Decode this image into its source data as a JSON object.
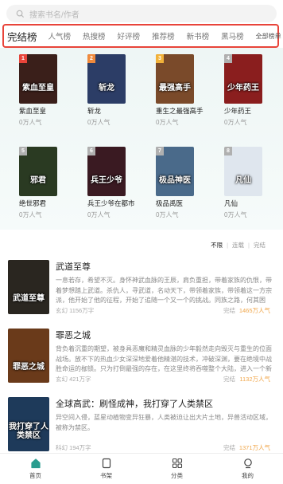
{
  "search": {
    "placeholder": "搜索书名/作者"
  },
  "rank_tabs": {
    "items": [
      "完结榜",
      "人气榜",
      "热搜榜",
      "好评榜",
      "推荐榜",
      "新书榜",
      "黑马榜"
    ],
    "all_label": "全部榜单",
    "all_chevron": "›"
  },
  "rank_books": [
    {
      "rank": "1",
      "title": "紫血至皇",
      "pop": "0万人气",
      "cover_text": "紫血至皇",
      "rank_color": "#e8443a",
      "cover_color": "#3a1f1a"
    },
    {
      "rank": "2",
      "title": "斩龙",
      "pop": "0万人气",
      "cover_text": "斩龙",
      "rank_color": "#f08a3c",
      "cover_color": "#2c3d66"
    },
    {
      "rank": "3",
      "title": "重生之最强高手",
      "pop": "0万人气",
      "cover_text": "最强高手",
      "rank_color": "#f2b23a",
      "cover_color": "#7a4a2a"
    },
    {
      "rank": "4",
      "title": "少年药王",
      "pop": "0万人气",
      "cover_text": "少年药王",
      "rank_color": "#b0b0b0",
      "cover_color": "#8a1e1e"
    },
    {
      "rank": "5",
      "title": "绝世邪君",
      "pop": "0万人气",
      "cover_text": "邪君",
      "rank_color": "#b0b0b0",
      "cover_color": "#2a3a22"
    },
    {
      "rank": "6",
      "title": "兵王少爷在都市",
      "pop": "0万人气",
      "cover_text": "兵王少爷",
      "rank_color": "#b0b0b0",
      "cover_color": "#3a1a22"
    },
    {
      "rank": "7",
      "title": "极品禹医",
      "pop": "0万人气",
      "cover_text": "极品神医",
      "rank_color": "#b0b0b0",
      "cover_color": "#4a6a8a"
    },
    {
      "rank": "8",
      "title": "凡仙",
      "pop": "0万人气",
      "cover_text": "凡仙",
      "rank_color": "#b0b0b0",
      "cover_color": "#dfe6ee"
    }
  ],
  "sort": {
    "options": [
      "不限",
      "连载",
      "完结"
    ]
  },
  "list_books": [
    {
      "title": "武道至尊",
      "desc": "一息若存，希望不灭。身怀神武血脉的王辰，肩负重担，带着家族的仇恨，带着梦想踏上武道。杀仇人，寻武道，名动天下，带领着家族，带领着这一方宗派，他开始了他的征程，开始了追随一个又一个的挑战。同族之路，何其困难。",
      "meta": "玄幻 1156万字",
      "status": "完结",
      "pop": "1465万人气",
      "cover_text": "武道至尊",
      "cover_color": "#2a2620"
    },
    {
      "title": "罪恶之城",
      "desc": "背负着沉重的期望，被身具恶魔和精灵血脉的少年毅然走向毁灭与重生的位面战场。放不下的热血少女深深地爱着他精湛的技术，冲破深渊，要在绝境中战胜命运的枷锁。只为打倒最强的存在，在这里终将吞噬整个大陆，进入一个新的领域。",
      "meta": "玄幻 421万字",
      "status": "完结",
      "pop": "1132万人气",
      "cover_text": "罪恶之城",
      "cover_color": "#6a3a1a"
    },
    {
      "title": "全球高武：刷怪成神，我打穿了人类禁区",
      "desc": "异空间入侵，蓝星动植物变异狂暴，人类被迫让出大片土地，异兽活动区域，被称为禁区。",
      "meta": "科幻 194万字",
      "status": "完结",
      "pop": "1371万人气",
      "cover_text": "我打穿了人类禁区",
      "cover_color": "#1e3a5a"
    }
  ],
  "tabbar": {
    "items": [
      "首页",
      "书架",
      "分类",
      "我的"
    ]
  },
  "colors": {
    "accent": "#e8443a",
    "pop": "#f0a64a"
  }
}
